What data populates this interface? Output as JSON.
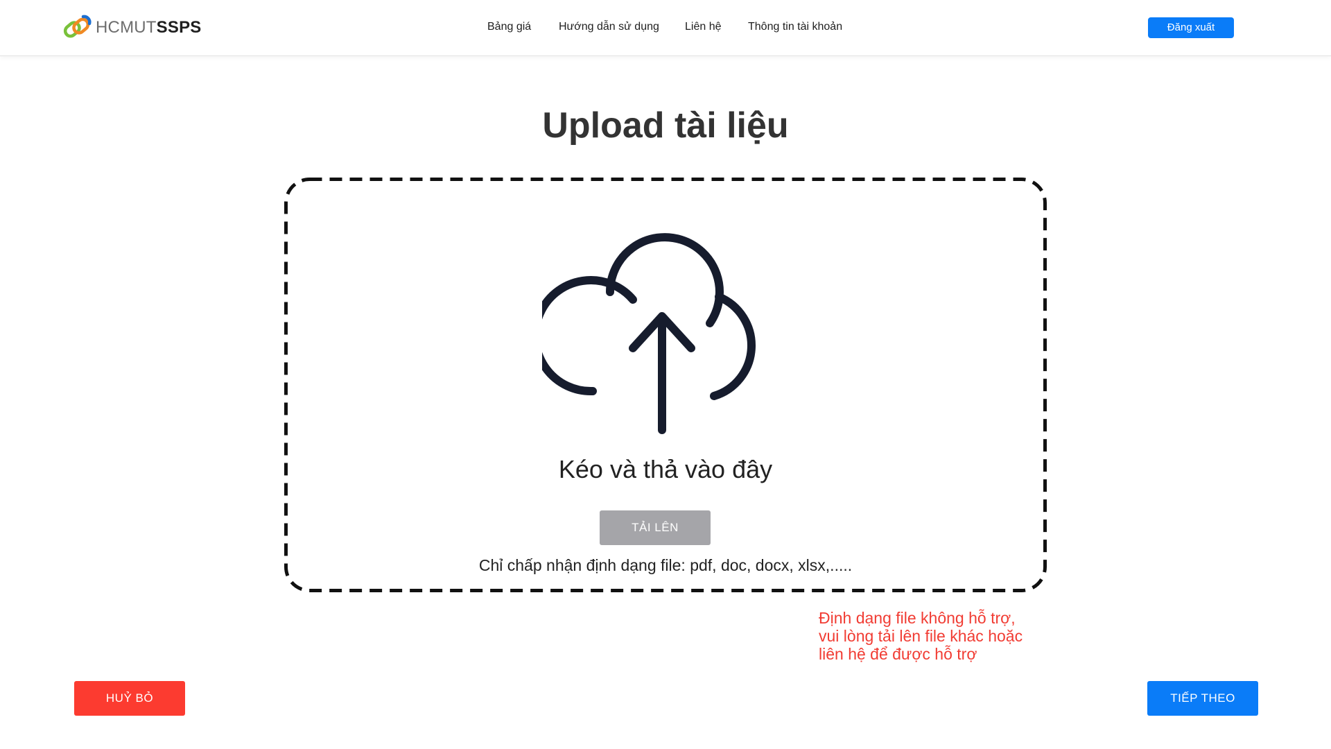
{
  "header": {
    "logo": {
      "text_light": "HCMUT",
      "text_bold": "SSPS",
      "icon": "linked-rings-logo-icon"
    },
    "nav": [
      {
        "label": "Bảng giá"
      },
      {
        "label": "Hướng dẫn sử dụng"
      },
      {
        "label": "Liên hệ"
      },
      {
        "label": "Thông tin tài khoản"
      }
    ],
    "logout_label": "Đăng xuất"
  },
  "main": {
    "title": "Upload tài liệu",
    "dropzone": {
      "icon": "cloud-upload-icon",
      "drag_text": "Kéo và thả vào đây",
      "upload_label": "TẢI LÊN",
      "formats_text": "Chỉ chấp nhận định dạng file: pdf, doc, docx, xlsx,....."
    },
    "error": {
      "lines": [
        "Định dạng file không hỗ trợ,",
        "vui lòng tải lên file khác hoặc",
        "liên hệ để được hỗ trợ"
      ]
    }
  },
  "footer": {
    "cancel_label": "HUỶ BỎ",
    "next_label": "TIẾP THEO"
  },
  "colors": {
    "primary": "#0a7cf8",
    "danger": "#fc3b30",
    "disabled": "#a5a5a9",
    "error_text": "#f13c33",
    "icon_dark": "#161c2d",
    "logo_orange": "#f08a24",
    "logo_green": "#79c13a",
    "logo_blue": "#1c6fd1"
  }
}
